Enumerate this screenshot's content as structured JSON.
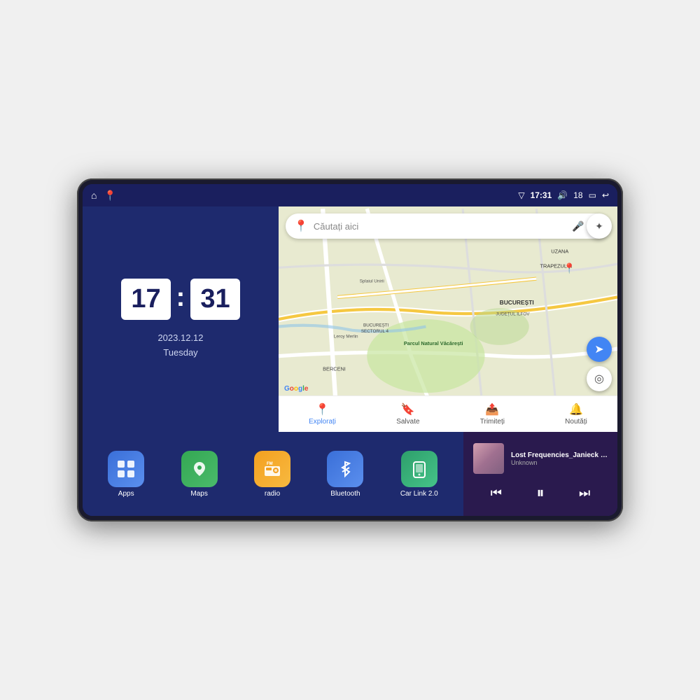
{
  "device": {
    "status_bar": {
      "left_icons": [
        "home-icon",
        "maps-nav-icon"
      ],
      "time": "17:31",
      "signal_icon": "signal-icon",
      "volume_icon": "volume-icon",
      "volume_level": "18",
      "battery_icon": "battery-icon",
      "back_icon": "back-icon"
    },
    "clock": {
      "hour": "17",
      "minute": "31",
      "date": "2023.12.12",
      "day": "Tuesday"
    },
    "map": {
      "search_placeholder": "Căutați aici",
      "bottom_nav": [
        {
          "label": "Explorați",
          "active": true
        },
        {
          "label": "Salvate",
          "active": false
        },
        {
          "label": "Trimiteți",
          "active": false
        },
        {
          "label": "Noutăți",
          "active": false
        }
      ]
    },
    "apps": [
      {
        "id": "apps",
        "label": "Apps",
        "icon_class": "icon-apps",
        "icon_char": "⊞"
      },
      {
        "id": "maps",
        "label": "Maps",
        "icon_class": "icon-maps",
        "icon_char": "📍"
      },
      {
        "id": "radio",
        "label": "radio",
        "icon_class": "icon-radio",
        "icon_char": "📻"
      },
      {
        "id": "bluetooth",
        "label": "Bluetooth",
        "icon_class": "icon-bluetooth",
        "icon_char": "🔷"
      },
      {
        "id": "carlink",
        "label": "Car Link 2.0",
        "icon_class": "icon-carlink",
        "icon_char": "📱"
      }
    ],
    "music": {
      "title": "Lost Frequencies_Janieck Devy-...",
      "artist": "Unknown",
      "prev_label": "⏮",
      "play_label": "⏸",
      "next_label": "⏭"
    }
  }
}
